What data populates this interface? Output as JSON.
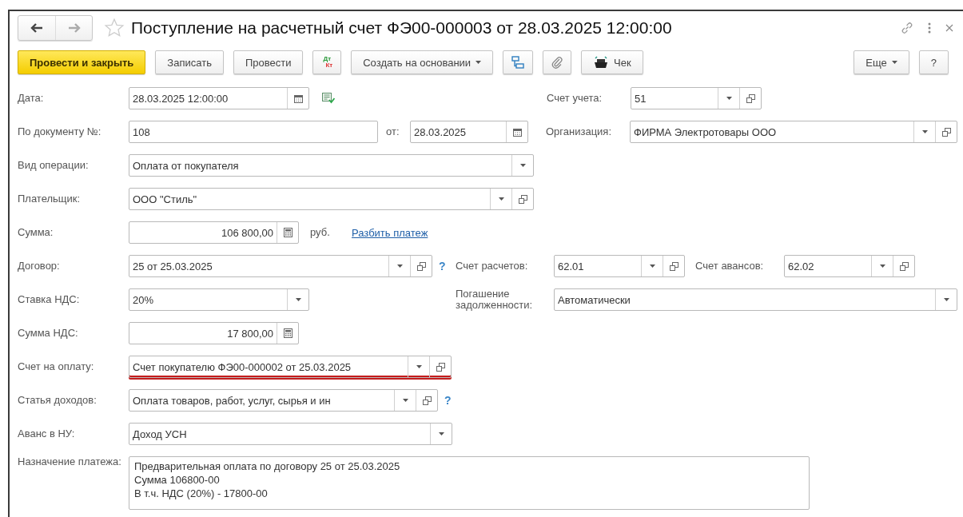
{
  "window": {
    "title": "Поступление на расчетный счет ФЭ00-000003 от 28.03.2025 12:00:00",
    "favorite": false,
    "nav": [
      {
        "kind": "back",
        "disabled": false
      },
      {
        "kind": "forward",
        "disabled": true
      }
    ],
    "actions": [
      {
        "kind": "link"
      },
      {
        "kind": "more"
      },
      {
        "kind": "close"
      }
    ]
  },
  "toolbar": {
    "left": [
      {
        "kind": "primary",
        "label": "Провести и закрыть"
      },
      {
        "kind": "plain",
        "label": "Записать"
      },
      {
        "kind": "plain",
        "label": "Провести"
      },
      {
        "kind": "dtkt",
        "top": "Дт",
        "bottom": "Кт"
      },
      {
        "kind": "dropdown",
        "label": "Создать на основании"
      },
      {
        "kind": "structure"
      },
      {
        "kind": "attachment"
      },
      {
        "kind": "receipt",
        "label": "Чек"
      }
    ],
    "right": [
      {
        "kind": "dropdown",
        "label": "Еще"
      },
      {
        "kind": "plain",
        "label": "?"
      }
    ]
  },
  "form": {
    "rows": [
      {
        "items": [
          {
            "kind": "label",
            "text": "Дата:"
          },
          {
            "kind": "field",
            "value": "28.03.2025 12:00:00",
            "buttons": [
              {
                "kind": "calendar"
              }
            ],
            "flagged": false
          },
          {
            "kind": "status_icon"
          },
          {
            "kind": "label",
            "text": "Счет учета:"
          },
          {
            "kind": "field",
            "value": "51",
            "buttons": [
              {
                "kind": "dropdown"
              },
              {
                "kind": "open"
              }
            ],
            "flagged": false
          }
        ]
      },
      {
        "items": [
          {
            "kind": "label",
            "text": "По документу №:"
          },
          {
            "kind": "field",
            "value": "108",
            "flagged": false
          },
          {
            "kind": "label",
            "text": "от:"
          },
          {
            "kind": "field",
            "value": "28.03.2025",
            "buttons": [
              {
                "kind": "calendar"
              }
            ],
            "flagged": false
          },
          {
            "kind": "label",
            "text": "Организация:"
          },
          {
            "kind": "field",
            "value": "ФИРМА Электротовары ООО",
            "buttons": [
              {
                "kind": "dropdown"
              },
              {
                "kind": "open"
              }
            ],
            "flagged": false
          }
        ]
      },
      {
        "items": [
          {
            "kind": "label",
            "text": "Вид операции:"
          },
          {
            "kind": "field",
            "value": "Оплата от покупателя",
            "buttons": [
              {
                "kind": "dropdown"
              }
            ],
            "flagged": false
          }
        ]
      },
      {
        "items": [
          {
            "kind": "label",
            "text": "Плательщик:"
          },
          {
            "kind": "field",
            "value": "ООО \"Стиль\"",
            "buttons": [
              {
                "kind": "dropdown"
              },
              {
                "kind": "open"
              }
            ],
            "flagged": false
          }
        ]
      },
      {
        "items": [
          {
            "kind": "label",
            "text": "Сумма:"
          },
          {
            "kind": "number",
            "value": "106 800,00",
            "buttons": [
              {
                "kind": "calculator"
              }
            ],
            "flagged": false
          },
          {
            "kind": "label",
            "text": "руб."
          },
          {
            "kind": "link",
            "text": "Разбить платеж"
          }
        ]
      },
      {
        "items": [
          {
            "kind": "label",
            "text": "Договор:"
          },
          {
            "kind": "field",
            "value": "25 от 25.03.2025",
            "buttons": [
              {
                "kind": "dropdown"
              },
              {
                "kind": "open"
              }
            ],
            "flagged": false
          },
          {
            "kind": "help",
            "text": "?"
          },
          {
            "kind": "label",
            "text": "Счет расчетов:"
          },
          {
            "kind": "field",
            "value": "62.01",
            "buttons": [
              {
                "kind": "dropdown"
              },
              {
                "kind": "open"
              }
            ],
            "flagged": false
          },
          {
            "kind": "label",
            "text": "Счет авансов:"
          },
          {
            "kind": "field",
            "value": "62.02",
            "buttons": [
              {
                "kind": "dropdown"
              },
              {
                "kind": "open"
              }
            ],
            "flagged": false
          }
        ]
      },
      {
        "items": [
          {
            "kind": "label",
            "text": "Ставка НДС:"
          },
          {
            "kind": "field",
            "value": "20%",
            "buttons": [
              {
                "kind": "dropdown"
              }
            ],
            "flagged": false
          },
          {
            "kind": "label",
            "text": "Погашение задолженности:"
          },
          {
            "kind": "field",
            "value": "Автоматически",
            "buttons": [
              {
                "kind": "dropdown"
              }
            ],
            "flagged": false
          }
        ]
      },
      {
        "items": [
          {
            "kind": "label",
            "text": "Сумма НДС:"
          },
          {
            "kind": "number",
            "value": "17 800,00",
            "buttons": [
              {
                "kind": "calculator"
              }
            ],
            "flagged": false
          }
        ]
      },
      {
        "items": [
          {
            "kind": "label",
            "text": "Счет на оплату:"
          },
          {
            "kind": "field",
            "value": "Счет покупателю ФЭ00-000002 от 25.03.2025",
            "buttons": [
              {
                "kind": "dropdown"
              },
              {
                "kind": "open"
              }
            ],
            "flagged": true
          }
        ]
      },
      {
        "items": [
          {
            "kind": "label",
            "text": "Статья доходов:"
          },
          {
            "kind": "field",
            "value": "Оплата товаров, работ, услуг, сырья и ин",
            "buttons": [
              {
                "kind": "dropdown"
              },
              {
                "kind": "open"
              }
            ],
            "flagged": false
          },
          {
            "kind": "help",
            "text": "?"
          }
        ]
      },
      {
        "items": [
          {
            "kind": "label",
            "text": "Аванс в НУ:"
          },
          {
            "kind": "field",
            "value": "Доход УСН",
            "buttons": [
              {
                "kind": "dropdown"
              }
            ],
            "flagged": false
          }
        ]
      },
      {
        "items": [
          {
            "kind": "label",
            "text": "Назначение платежа:"
          },
          {
            "kind": "textarea",
            "lines": [
              "Предварительная оплата по договору 25 от 25.03.2025",
              "Сумма 106800-00",
              "В т.ч. НДС (20%) - 17800-00"
            ]
          }
        ]
      }
    ]
  }
}
